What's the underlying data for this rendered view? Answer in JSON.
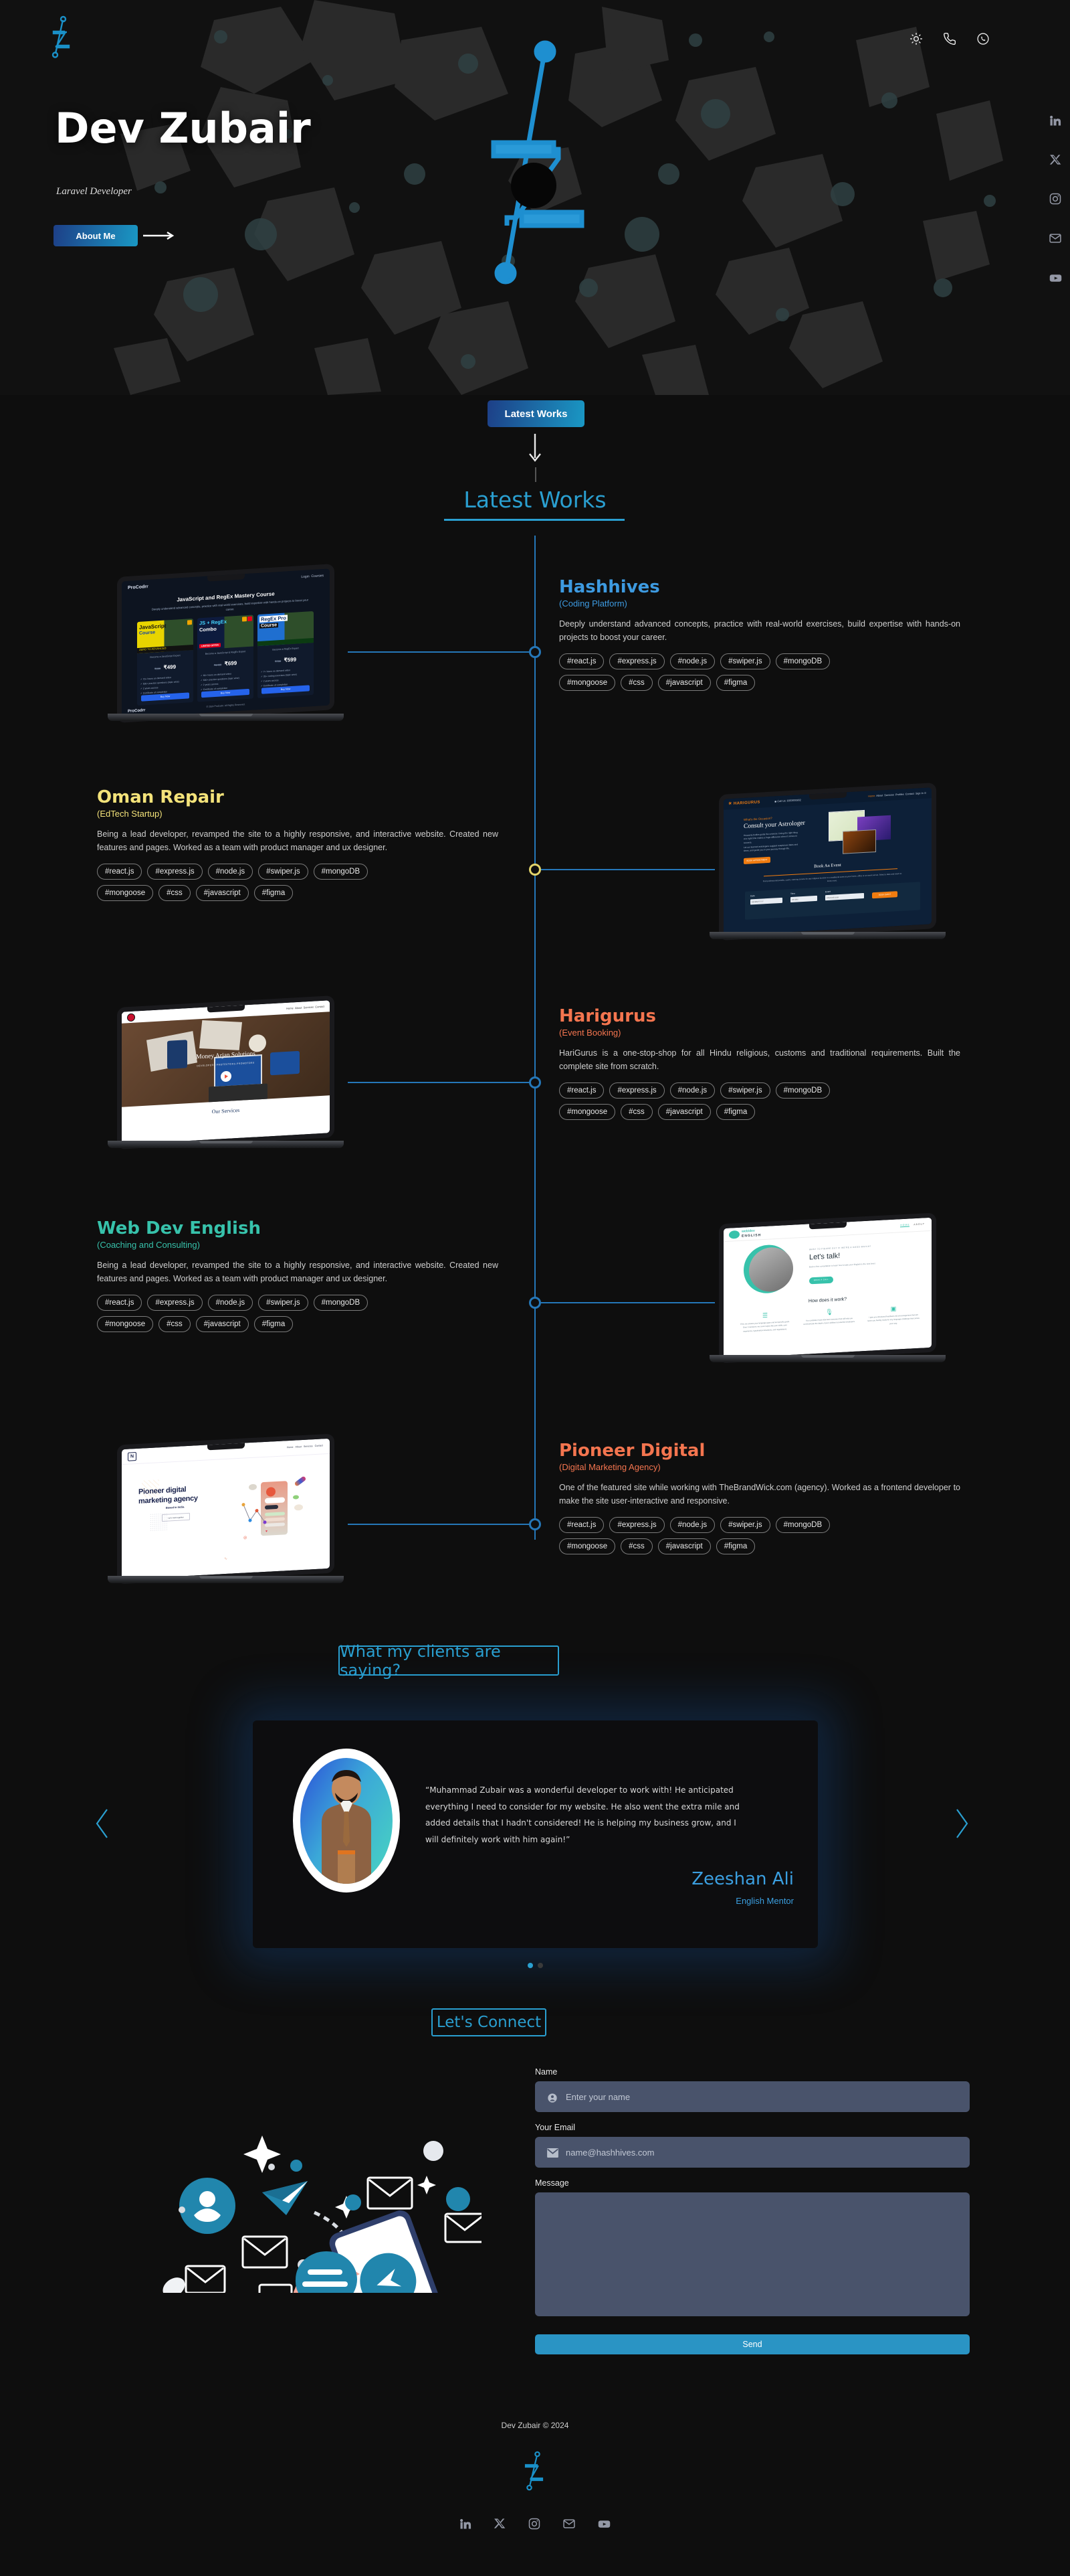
{
  "hero": {
    "name": "Dev Zubair",
    "role": "Laravel Developer",
    "about_button": "About Me",
    "logo_name": "dev-zubair-logo",
    "top_icons": [
      {
        "name": "theme-toggle-sun-icon",
        "label": "sun"
      },
      {
        "name": "phone-icon",
        "label": "phone"
      },
      {
        "name": "whatsapp-icon",
        "label": "whatsapp"
      }
    ],
    "social_rail": [
      {
        "name": "linkedin-icon",
        "label": "LinkedIn"
      },
      {
        "name": "x-twitter-icon",
        "label": "X"
      },
      {
        "name": "instagram-icon",
        "label": "Instagram"
      },
      {
        "name": "email-icon",
        "label": "Email"
      },
      {
        "name": "youtube-icon",
        "label": "YouTube"
      }
    ]
  },
  "works": {
    "badge_label": "Latest Works",
    "section_title": "Latest Works",
    "projects": [
      {
        "title": "Hashhives",
        "subtitle": "(Coding Platform)",
        "color": "#3d9ae0",
        "description": "Deeply understand advanced concepts, practice with real-world exercises, build expertise with hands-on projects to boost your career.",
        "tags_row1": [
          "#react.js",
          "#express.js",
          "#node.js",
          "#swiper.js",
          "#mongoDB"
        ],
        "tags_row2": [
          "#mongoose",
          "#css",
          "#javascript",
          "#figma"
        ],
        "mock": {
          "brand": "ProCodrr",
          "headline": "JavaScript and RegEx Mastery Course",
          "subhead": "Deeply understand advanced concepts, practice with real-world exercises, build expertise with hands-on projects to boost your career.",
          "nav": [
            "Login",
            "Courses"
          ],
          "cards": [
            {
              "title": "JavaScript Course",
              "ribbon": "ZERO TO ADVANCED",
              "old_price": "₹600",
              "price": "₹499",
              "subtitle": "Become a JavaScript Expert",
              "cta": "Buy Now",
              "bullets": [
                "70+ hours on demand video",
                "500+ practice questions (topic wise)",
                "2 years access",
                "Certificate of completion"
              ]
            },
            {
              "title": "JS + RegEx Combo",
              "ribbon": "LIMITED OFFER",
              "old_price": "₹1400",
              "price": "₹699",
              "subtitle": "Become a JavaScript & RegEx Expert",
              "cta": "Buy Now",
              "bullets": [
                "80+ hours on demand video",
                "600+ practice questions (topic wise)",
                "2 years access",
                "Certificate of completion"
              ]
            },
            {
              "title": "RegEx Pro Course",
              "ribbon": "",
              "old_price": "₹700",
              "price": "₹599",
              "subtitle": "Become a RegEx Expert",
              "cta": "Buy Now",
              "bullets": [
                "7+ hours on demand video",
                "35+ coding exercises (topic wise)",
                "2 years access",
                "Certificate of completion"
              ]
            }
          ],
          "footer": "© 2024 ProCodrr. All Rights Reserved."
        }
      },
      {
        "title": "Oman Repair",
        "subtitle": "(EdTech Startup)",
        "color": "#f4e37a",
        "description": "Being a lead developer, revamped the site to a highly responsive, and interactive website. Created new features and pages. Worked as a team with product manager and ux designer.",
        "tags_row1": [
          "#react.js",
          "#express.js",
          "#node.js",
          "#swiper.js",
          "#mongoDB"
        ],
        "tags_row2": [
          "#mongoose",
          "#css",
          "#javascript",
          "#figma"
        ],
        "mock": {
          "brand": "HARIGURUS",
          "eyebrow": "What's the Occasion?",
          "headline": "Consult your Astrologer",
          "body1": "Heavenly bodies guide the universe. Doing the right thing at a right time makes a huge difference when it comes to success.",
          "body2": "Let our learned astrologers suggest auspicious dates and times, and guide you in your journey through life.",
          "cta": "BOOK APPOINTMENT",
          "phone": "Call Us: 8353000802",
          "nav": [
            "Home",
            "About",
            "Services",
            "Profiles",
            "Contact",
            "Sign In"
          ],
          "section2_title": "Book An Event",
          "section2_sub": "Find professional pandits, cooks, catering service for any religious function or a traditional event at your home, office or an event venue. Select a date and event to know more.",
          "fields": [
            "Date",
            "Time",
            "Event"
          ],
          "field_values": [
            "DD/MM/YYYY",
            "HH:MM",
            "Antarvedi puja"
          ],
          "form_cta": "BOOK EVENT"
        }
      },
      {
        "title": "Harigurus",
        "subtitle": "(Event Booking)",
        "color": "#f4754f",
        "description": "HariGurus is a one-stop-shop for all Hindu religious, customs and traditional requirements. Built the complete site from scratch.",
        "tags_row1": [
          "#react.js",
          "#express.js",
          "#node.js",
          "#swiper.js",
          "#mongoDB"
        ],
        "tags_row2": [
          "#mongoose",
          "#css",
          "#javascript",
          "#figma"
        ],
        "mock": {
          "headline": "Money Arjan Solutions",
          "sub": "DEVELOPERS-PROTECTORS-PROMOTORS",
          "nav": [
            "Home",
            "About",
            "Services",
            "Contact"
          ],
          "section2_title": "Our Services"
        }
      },
      {
        "title": "Web Dev English",
        "subtitle": "(Coaching and Consulting)",
        "color": "#37c2ab",
        "description": "Being a lead developer, revamped the site to a highly responsive, and interactive website. Created new features and pages. Worked as a team with product manager and ux designer.",
        "tags_row1": [
          "#react.js",
          "#express.js",
          "#node.js",
          "#swiper.js",
          "#mongoDB"
        ],
        "tags_row2": [
          "#mongoose",
          "#css",
          "#javascript",
          "#figma"
        ],
        "mock": {
          "brand": "web/dev ENGLISH",
          "eyebrow": "WANT TO FIGURE OUT IF WE'RE A GOOD MATCH?",
          "headline": "Let's talk!",
          "body": "Book a free consultation to learn how to take your English to the next level.",
          "cta": "BOOK A CALL",
          "nav": [
            "HOME",
            "ABOUT"
          ],
          "section2_title": "How does it work?",
          "columns": [
            "First, we assess your language gaps and set specific goals. Over 5 sessions, we cover topics like your skills, your experience, hypothetical situations, and negotiations.",
            "You complete mock interview exercises that will help you communicate the depth of your abilities to potential employers.",
            "I give you structured feedback and encouragement that will leave you feeling ready for any language challenge that comes your way."
          ]
        }
      },
      {
        "title": "Pioneer Digital",
        "subtitle": "(Digital Marketing Agency)",
        "color": "#f4754f",
        "description": "One of the featured site while working with TheBrandWick.com (agency). Worked as a frontend developer to make the site user-interactive and responsive.",
        "tags_row1": [
          "#react.js",
          "#express.js",
          "#node.js",
          "#swiper.js",
          "#mongoDB"
        ],
        "tags_row2": [
          "#mongoose",
          "#css",
          "#javascript",
          "#figma"
        ],
        "mock": {
          "brand": "N",
          "headline": "Pioneer digital marketing agency",
          "sub": "Based in India.",
          "cta": "Let's work together",
          "nav": [
            "Home",
            "About",
            "Services",
            "Contact"
          ]
        }
      }
    ]
  },
  "testimonials": {
    "heading": "What my clients are saying?",
    "prev_label": "previous",
    "next_label": "next",
    "items": [
      {
        "quote": "“Muhammad Zubair was a wonderful developer to work with! He anticipated everything I need to consider for my website. He also went the extra mile and added details that I hadn't considered! He is helping my business grow, and I will definitely work with him again!”",
        "name": "Zeeshan Ali",
        "role": "English Mentor"
      }
    ],
    "dot_count": 2,
    "active_dot": 0
  },
  "contact": {
    "heading": "Let's Connect",
    "name_label": "Name",
    "name_placeholder": "Enter your name",
    "email_label": "Your Email",
    "email_placeholder": "name@hashhives.com",
    "message_label": "Message",
    "message_placeholder": "",
    "send_label": "Send"
  },
  "footer": {
    "copyright": "Dev Zubair © 2024",
    "logo_name": "dev-zubair-logo",
    "social": [
      {
        "name": "linkedin-icon",
        "label": "LinkedIn"
      },
      {
        "name": "x-twitter-icon",
        "label": "X"
      },
      {
        "name": "instagram-icon",
        "label": "Instagram"
      },
      {
        "name": "email-icon",
        "label": "Email"
      },
      {
        "name": "youtube-icon",
        "label": "YouTube"
      }
    ]
  },
  "colors": {
    "accent": "#2a9fd0",
    "timeline": "#2577b8",
    "background": "#0e0e0e",
    "input_bg": "#49536b"
  }
}
